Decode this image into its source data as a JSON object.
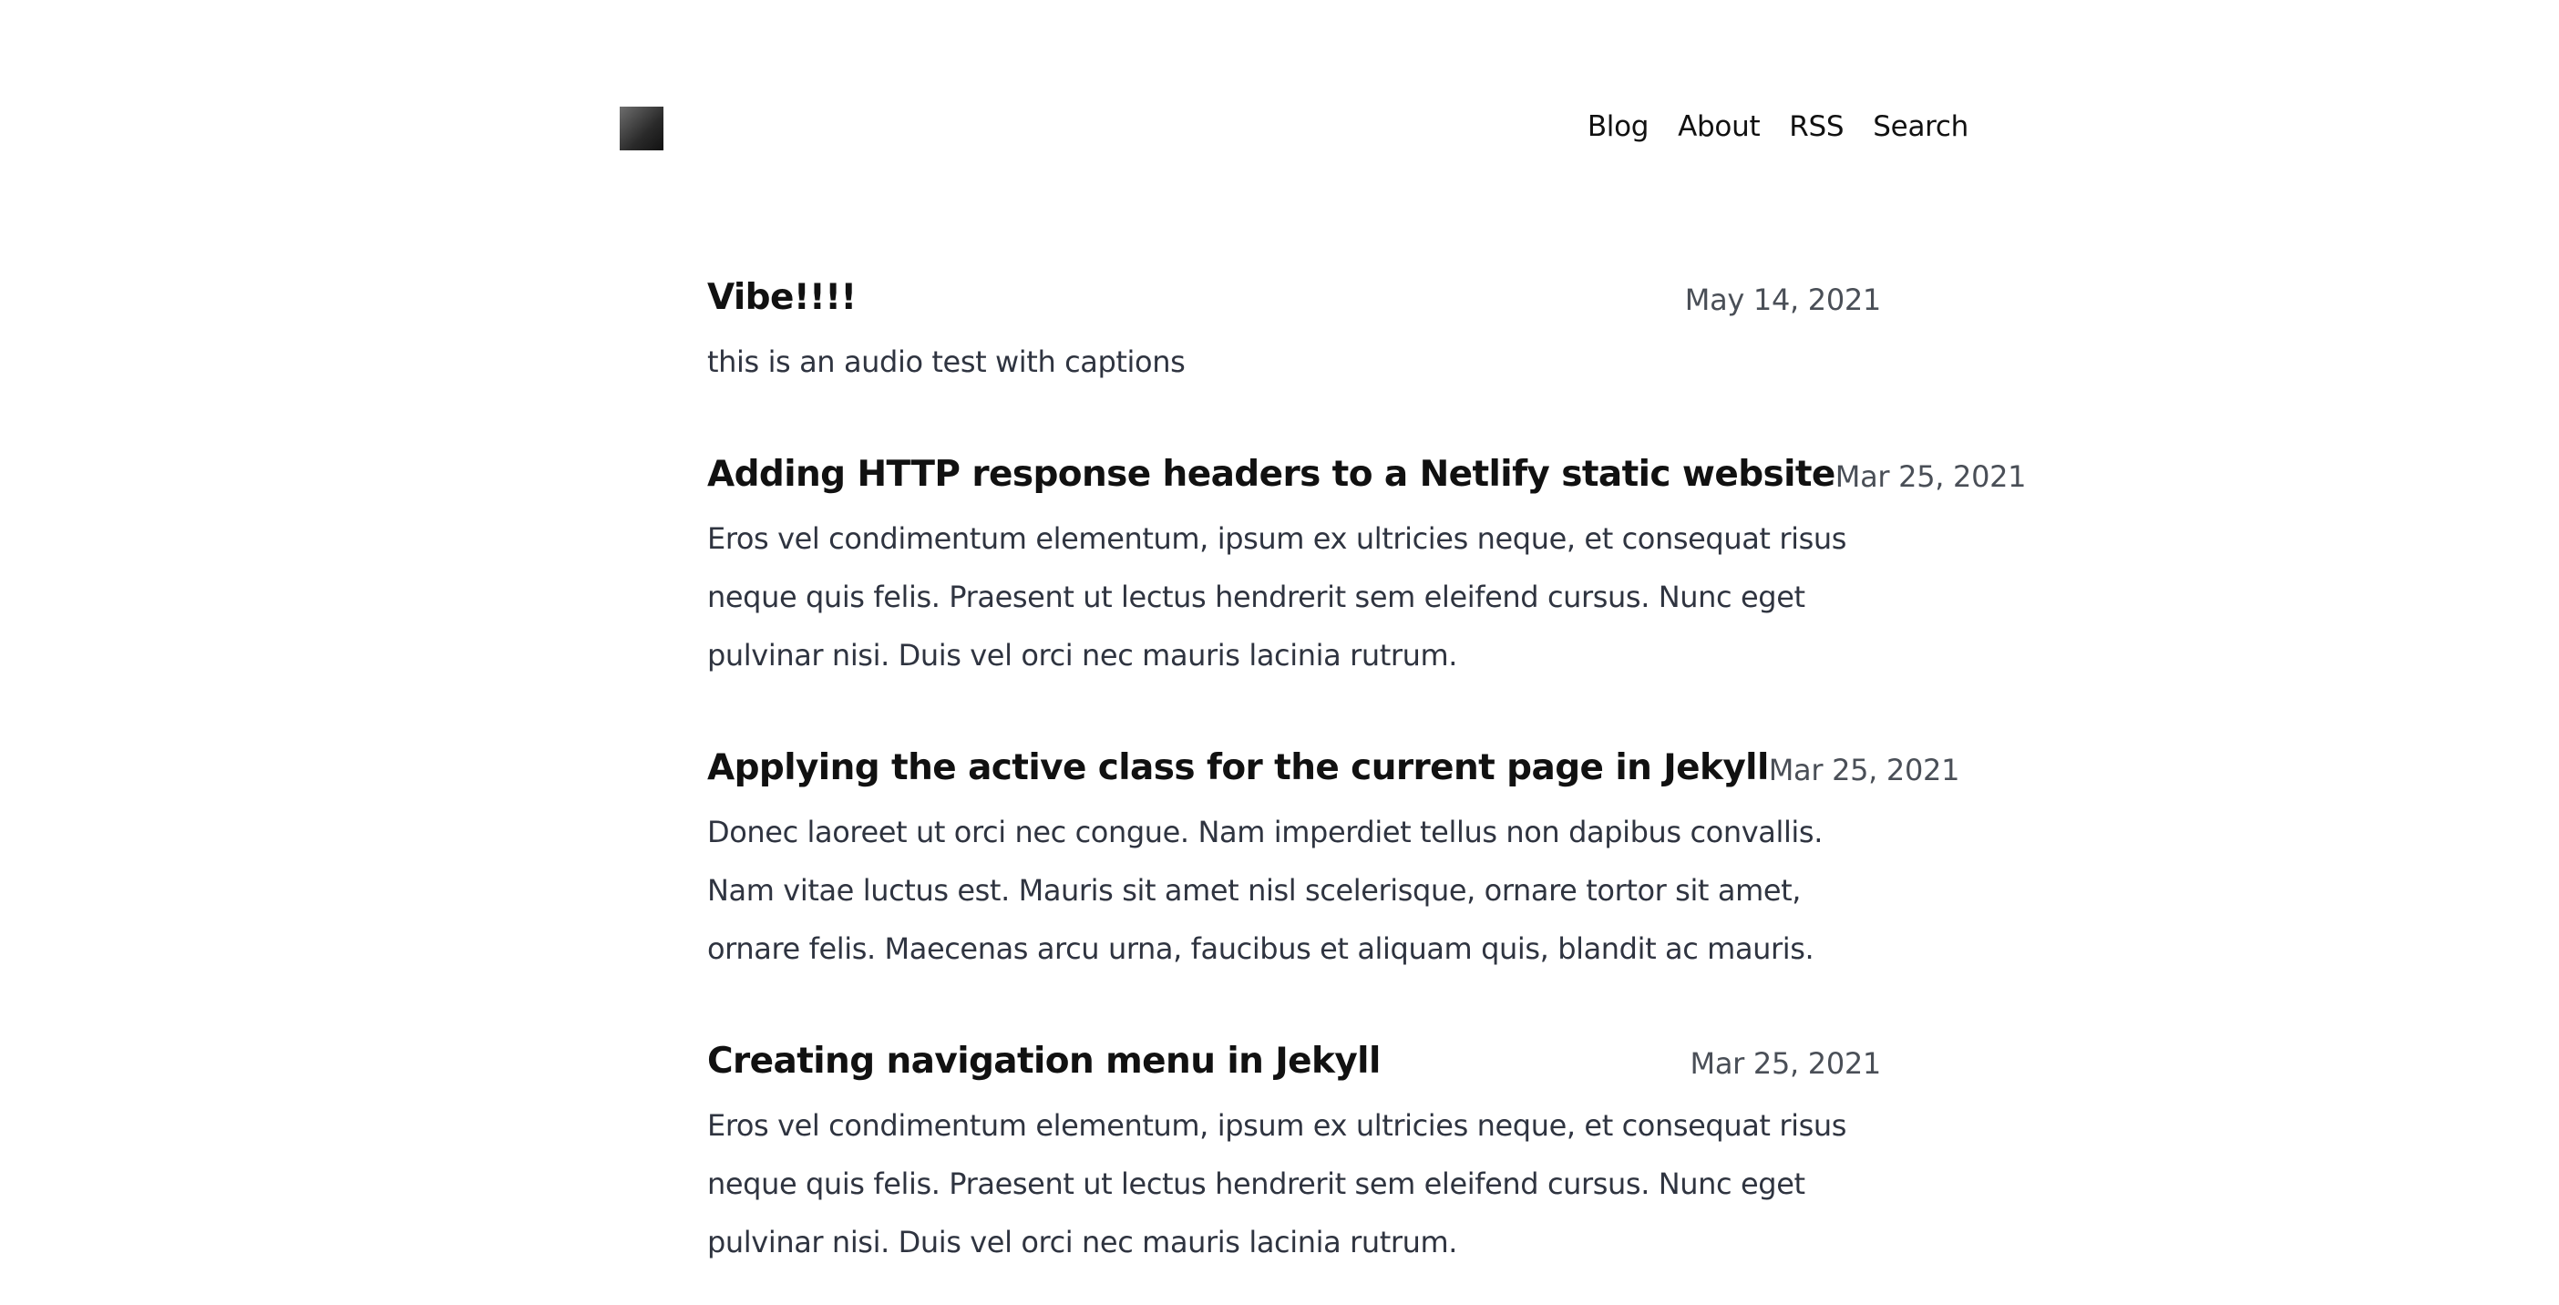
{
  "header": {
    "logo": "site-logo",
    "nav": [
      {
        "label": "Blog"
      },
      {
        "label": "About"
      },
      {
        "label": "RSS"
      },
      {
        "label": "Search"
      }
    ]
  },
  "posts": [
    {
      "title": "Vibe!!!!",
      "date": "May 14, 2021",
      "excerpt": "this is an audio test with captions"
    },
    {
      "title": "Adding HTTP response headers to a Netlify static website",
      "date": "Mar 25, 2021",
      "excerpt": "Eros vel condimentum elementum, ipsum ex ultricies neque, et consequat risus neque quis felis. Praesent ut lectus hendrerit sem eleifend cursus. Nunc eget pulvinar nisi. Duis vel orci nec mauris lacinia rutrum."
    },
    {
      "title": "Applying the active class for the current page in Jekyll",
      "date": "Mar 25, 2021",
      "excerpt": "Donec laoreet ut orci nec congue. Nam imperdiet tellus non dapibus convallis. Nam vitae luctus est. Mauris sit amet nisl scelerisque, ornare tortor sit amet, ornare felis. Maecenas arcu urna, faucibus et aliquam quis, blandit ac mauris."
    },
    {
      "title": "Creating navigation menu in Jekyll",
      "date": "Mar 25, 2021",
      "excerpt": "Eros vel condimentum elementum, ipsum ex ultricies neque, et consequat risus neque quis felis. Praesent ut lectus hendrerit sem eleifend cursus. Nunc eget pulvinar nisi. Duis vel orci nec mauris lacinia rutrum."
    }
  ]
}
